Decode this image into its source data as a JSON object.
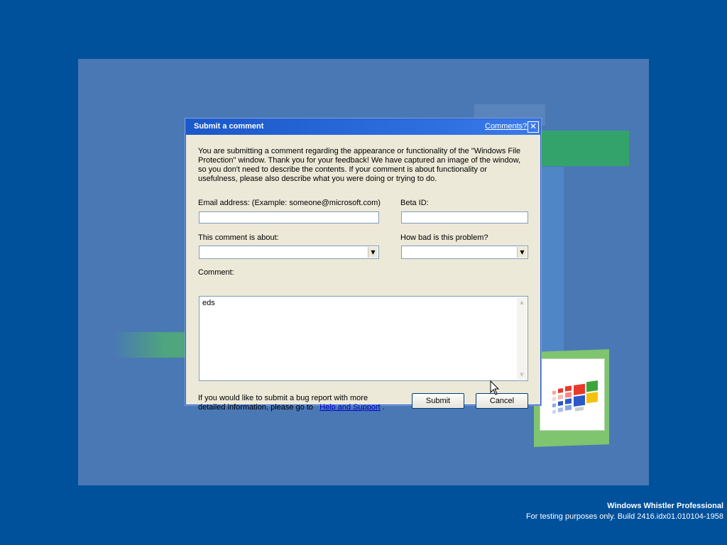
{
  "dialog": {
    "title": "Submit a comment",
    "title_link": "Comments?",
    "close_glyph": "✕",
    "intro": "You are submitting a comment regarding the appearance or functionality of the \"Windows File Protection\" window. Thank you for your feedback! We have captured an image of the window, so you don't need to describe the contents. If your comment is about functionality or usefulness, please also describe what you were doing or trying to do.",
    "email_label": "Email address: (Example: someone@microsoft.com)",
    "email_value": "",
    "beta_label": "Beta ID:",
    "beta_value": "",
    "about_label": "This comment is about:",
    "about_value": "",
    "severity_label": "How bad is this problem?",
    "severity_value": "",
    "comment_label": "Comment:",
    "comment_value": "eds",
    "footer_text": "If you would like to submit a bug report with more detailed information, please go to",
    "footer_link": "Help and Support",
    "footer_end": ".",
    "submit_label": "Submit",
    "cancel_label": "Cancel"
  },
  "watermark": {
    "line1": "Windows Whistler Professional",
    "line2": "For testing purposes only. Build 2416.idx01.010104-1958"
  },
  "icons": {
    "close": "close-icon",
    "dropdown": "chevron-down-icon",
    "cursor": "mouse-pointer-icon",
    "logo": "windows-flag-logo"
  },
  "colors": {
    "desktop": "#00519c",
    "titlebar": "#2e6fe0",
    "dialog_bg": "#ece9d8",
    "link": "#0000cc"
  }
}
